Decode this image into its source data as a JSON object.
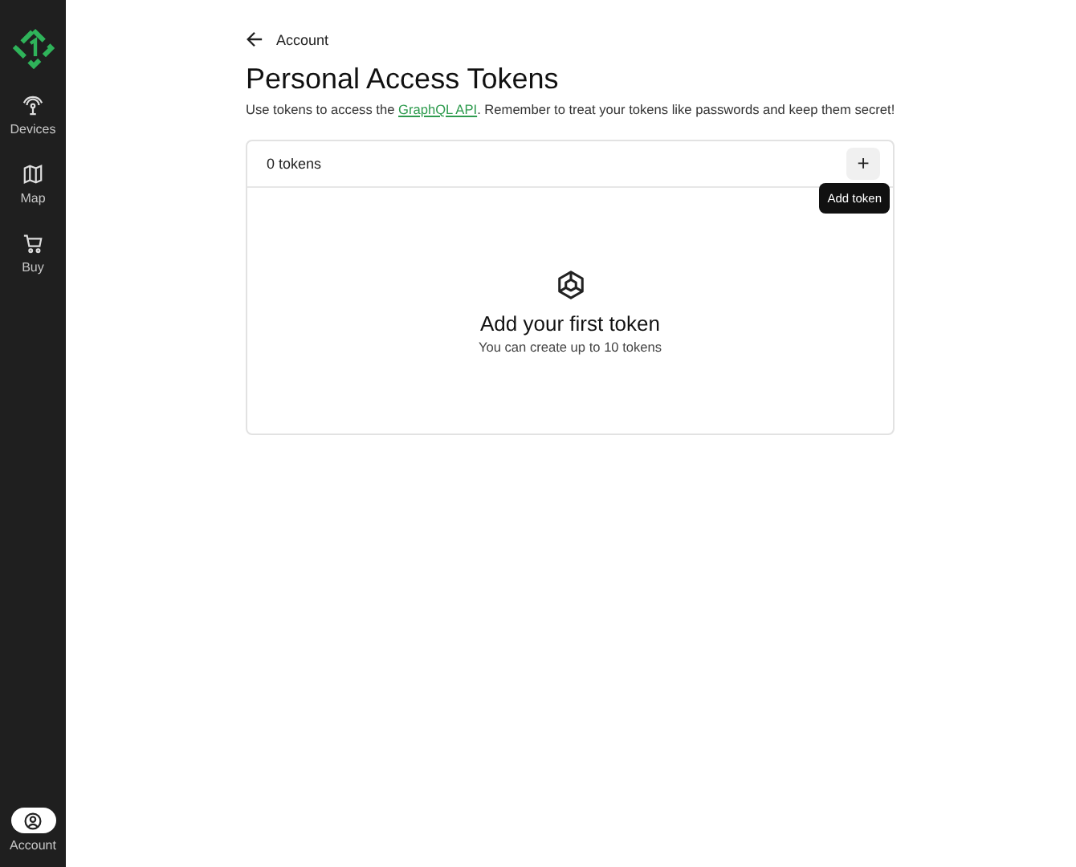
{
  "sidebar": {
    "items": [
      {
        "kind": "devices",
        "label": "Devices",
        "selected": false
      },
      {
        "kind": "map",
        "label": "Map",
        "selected": false
      },
      {
        "kind": "buy",
        "label": "Buy",
        "selected": false
      }
    ],
    "account": {
      "label": "Account",
      "selected": true
    }
  },
  "back_link": "Account",
  "title": "Personal Access Tokens",
  "description": {
    "before": "Use tokens to access the ",
    "link": "GraphQL API",
    "after": ". Remember to treat your tokens like passwords and keep them secret!"
  },
  "card": {
    "count": "0 tokens",
    "add_button": "+",
    "tooltip": "Add token",
    "empty_title": "Add your first token",
    "empty_subtitle": "You can create up to 10 tokens"
  }
}
